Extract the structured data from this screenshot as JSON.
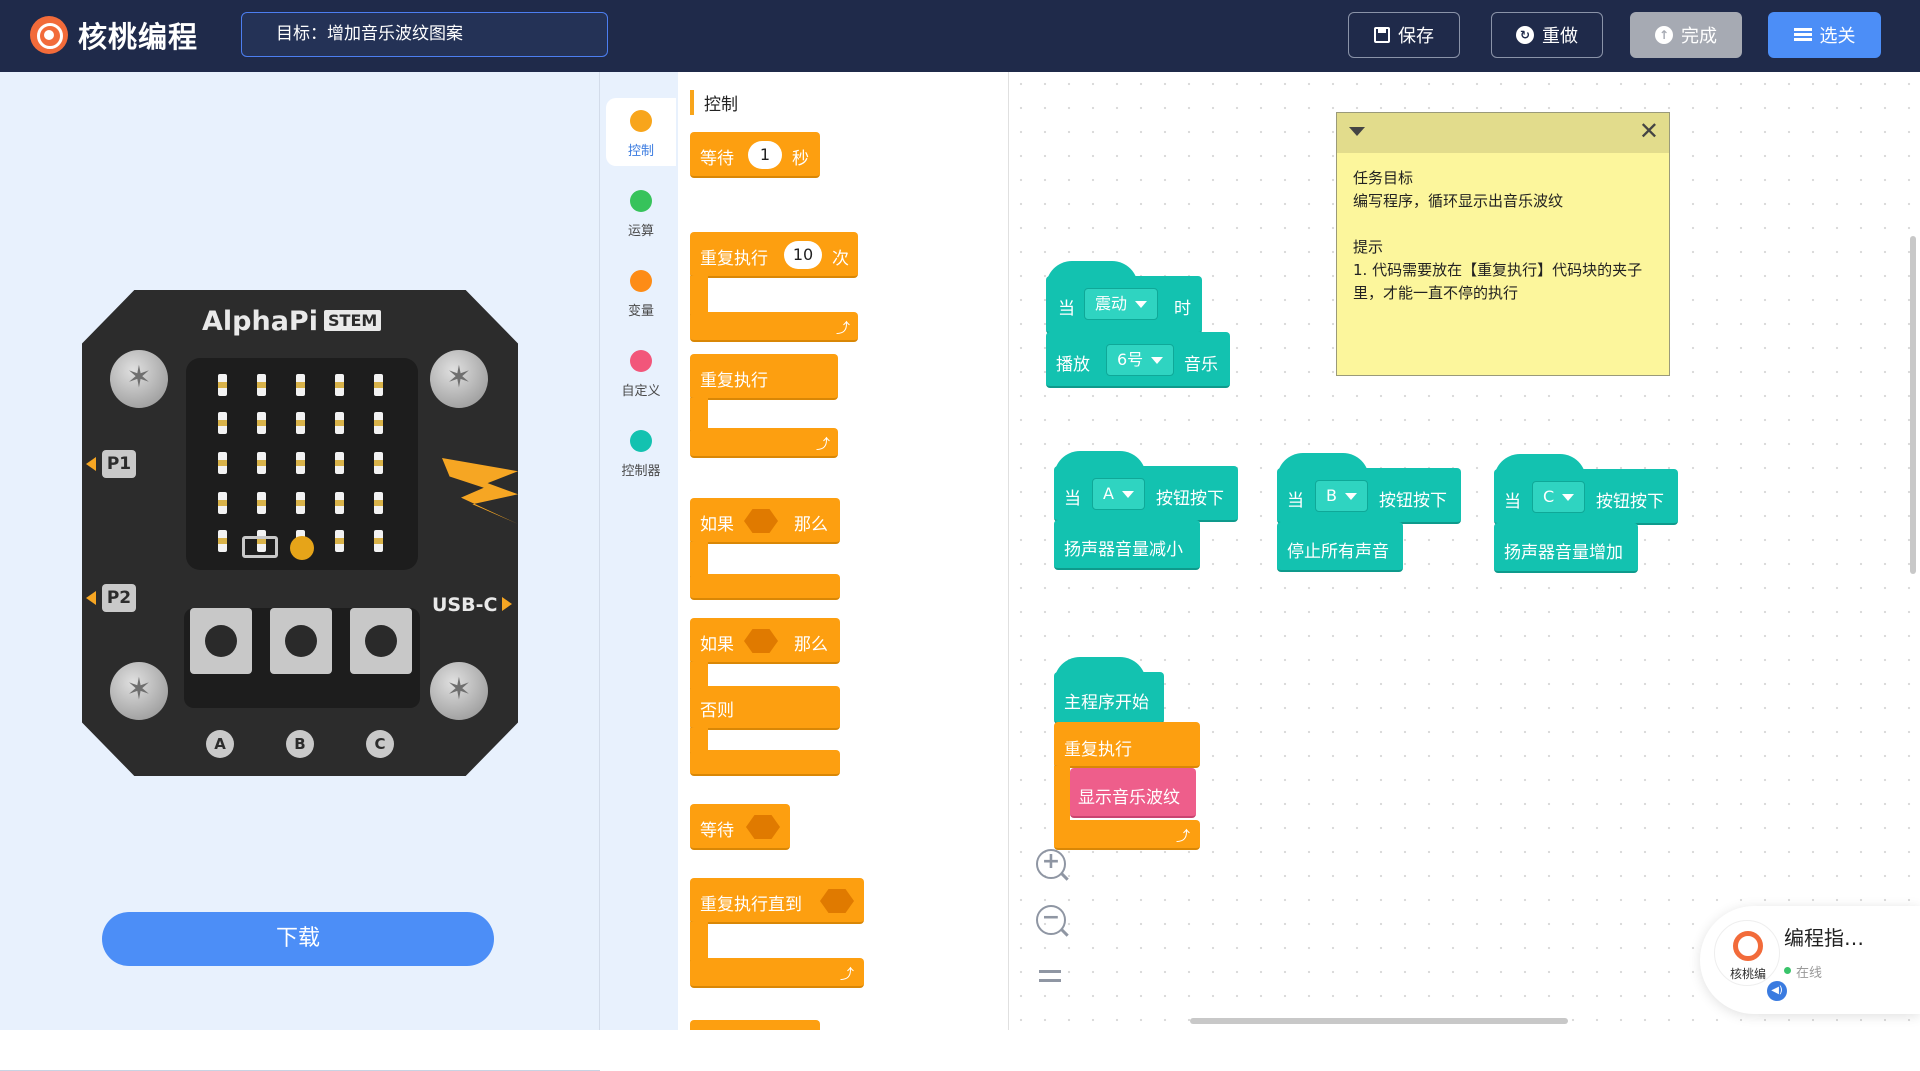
{
  "app": {
    "name": "核桃编程"
  },
  "header": {
    "goal": "目标：增加音乐波纹图案",
    "save_label": "保存",
    "redo_label": "重做",
    "done_label": "完成",
    "levels_label": "选关"
  },
  "device": {
    "title": "AlphaPi",
    "tag": "STEM",
    "pin1": "P1",
    "pin2": "P2",
    "usb": "USB-C",
    "buttons": [
      "A",
      "B",
      "C"
    ]
  },
  "left": {
    "download_label": "下载"
  },
  "categories": [
    {
      "label": "控制",
      "color": "#f8a51b"
    },
    {
      "label": "运算",
      "color": "#37c35b"
    },
    {
      "label": "变量",
      "color": "#fd8c16"
    },
    {
      "label": "自定义",
      "color": "#f2567a"
    },
    {
      "label": "控制器",
      "color": "#13c2b0"
    }
  ],
  "palette": {
    "title": "控制",
    "wait_label": "等待",
    "wait_value": "1",
    "wait_unit": "秒",
    "repeat_n_label": "重复执行",
    "repeat_n_value": "10",
    "repeat_n_unit": "次",
    "forever_label": "重复执行",
    "if_label": "如果",
    "then_label": "那么",
    "if2_label": "如果",
    "then2_label": "那么",
    "else_label": "否则",
    "wait_until_label": "等待",
    "repeat_until_label": "重复执行直到"
  },
  "workspace": {
    "shake_when": "当",
    "shake_event": "震动",
    "shake_time": "时",
    "play_label": "播放",
    "play_value": "6号",
    "play_unit": "音乐",
    "btnA": {
      "when": "当",
      "key": "A",
      "pressed": "按钮按下",
      "action": "扬声器音量减小"
    },
    "btnB": {
      "when": "当",
      "key": "B",
      "pressed": "按钮按下",
      "action": "停止所有声音"
    },
    "btnC": {
      "when": "当",
      "key": "C",
      "pressed": "按钮按下",
      "action": "扬声器音量增加"
    },
    "main_start": "主程序开始",
    "main_repeat": "重复执行",
    "main_show": "显示音乐波纹"
  },
  "note": {
    "lines": [
      "任务目标",
      "编写程序，循环显示出音乐波纹",
      "",
      "提示",
      "1. 代码需要放在【重复执行】代码块的夹子里，才能一直不停的执行"
    ]
  },
  "assistant": {
    "name": "编程指…",
    "status": "在线",
    "logo_text": "核桃编"
  }
}
